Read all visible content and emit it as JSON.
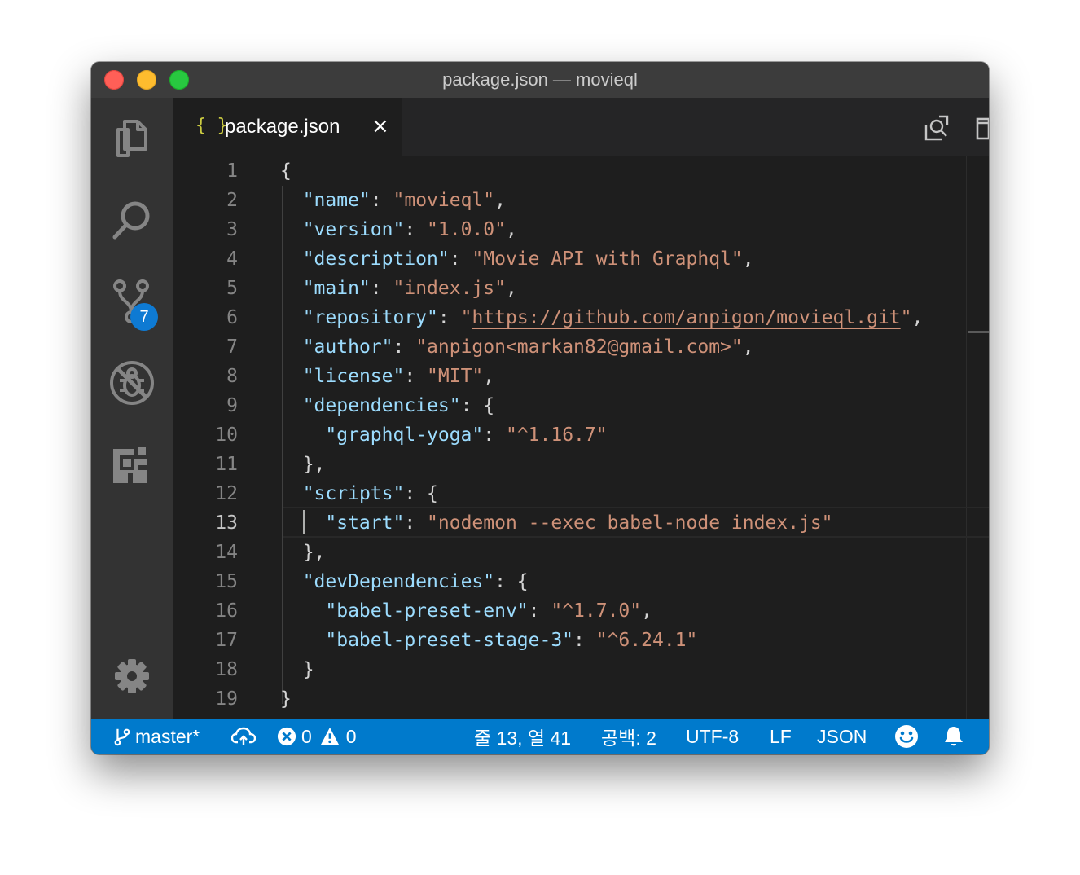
{
  "window": {
    "title": "package.json — movieql"
  },
  "activity_bar": {
    "items": [
      {
        "name": "explorer",
        "icon": "files-icon"
      },
      {
        "name": "search",
        "icon": "search-icon"
      },
      {
        "name": "source-control",
        "icon": "source-control-icon",
        "badge": "7"
      },
      {
        "name": "debug",
        "icon": "debug-disabled-icon"
      },
      {
        "name": "extensions",
        "icon": "extensions-icon"
      }
    ],
    "settings_icon": "gear-icon"
  },
  "tab": {
    "icon_text": "{ }",
    "label": "package.json",
    "close": "×"
  },
  "tab_actions": [
    "open-preview-icon",
    "split-editor-icon",
    "more-actions-icon"
  ],
  "editor": {
    "active_line": 13,
    "lines": [
      {
        "n": "1",
        "tokens": [
          {
            "t": "{",
            "c": "p"
          }
        ]
      },
      {
        "n": "2",
        "tokens": [
          {
            "t": "  ",
            "c": "p"
          },
          {
            "t": "\"name\"",
            "c": "k"
          },
          {
            "t": ": ",
            "c": "p"
          },
          {
            "t": "\"movieql\"",
            "c": "s"
          },
          {
            "t": ",",
            "c": "p"
          }
        ]
      },
      {
        "n": "3",
        "tokens": [
          {
            "t": "  ",
            "c": "p"
          },
          {
            "t": "\"version\"",
            "c": "k"
          },
          {
            "t": ": ",
            "c": "p"
          },
          {
            "t": "\"1.0.0\"",
            "c": "s"
          },
          {
            "t": ",",
            "c": "p"
          }
        ]
      },
      {
        "n": "4",
        "tokens": [
          {
            "t": "  ",
            "c": "p"
          },
          {
            "t": "\"description\"",
            "c": "k"
          },
          {
            "t": ": ",
            "c": "p"
          },
          {
            "t": "\"Movie API with Graphql\"",
            "c": "s"
          },
          {
            "t": ",",
            "c": "p"
          }
        ]
      },
      {
        "n": "5",
        "tokens": [
          {
            "t": "  ",
            "c": "p"
          },
          {
            "t": "\"main\"",
            "c": "k"
          },
          {
            "t": ": ",
            "c": "p"
          },
          {
            "t": "\"index.js\"",
            "c": "s"
          },
          {
            "t": ",",
            "c": "p"
          }
        ]
      },
      {
        "n": "6",
        "tokens": [
          {
            "t": "  ",
            "c": "p"
          },
          {
            "t": "\"repository\"",
            "c": "k"
          },
          {
            "t": ": ",
            "c": "p"
          },
          {
            "t": "\"",
            "c": "s"
          },
          {
            "t": "https://github.com/anpigon/movieql.git",
            "c": "s u"
          },
          {
            "t": "\"",
            "c": "s"
          },
          {
            "t": ",",
            "c": "p"
          }
        ]
      },
      {
        "n": "7",
        "tokens": [
          {
            "t": "  ",
            "c": "p"
          },
          {
            "t": "\"author\"",
            "c": "k"
          },
          {
            "t": ": ",
            "c": "p"
          },
          {
            "t": "\"anpigon<markan82@gmail.com>\"",
            "c": "s"
          },
          {
            "t": ",",
            "c": "p"
          }
        ]
      },
      {
        "n": "8",
        "tokens": [
          {
            "t": "  ",
            "c": "p"
          },
          {
            "t": "\"license\"",
            "c": "k"
          },
          {
            "t": ": ",
            "c": "p"
          },
          {
            "t": "\"MIT\"",
            "c": "s"
          },
          {
            "t": ",",
            "c": "p"
          }
        ]
      },
      {
        "n": "9",
        "tokens": [
          {
            "t": "  ",
            "c": "p"
          },
          {
            "t": "\"dependencies\"",
            "c": "k"
          },
          {
            "t": ": {",
            "c": "p"
          }
        ]
      },
      {
        "n": "10",
        "tokens": [
          {
            "t": "    ",
            "c": "p"
          },
          {
            "t": "\"graphql-yoga\"",
            "c": "k"
          },
          {
            "t": ": ",
            "c": "p"
          },
          {
            "t": "\"^1.16.7\"",
            "c": "s"
          }
        ]
      },
      {
        "n": "11",
        "tokens": [
          {
            "t": "  },",
            "c": "p"
          }
        ]
      },
      {
        "n": "12",
        "tokens": [
          {
            "t": "  ",
            "c": "p"
          },
          {
            "t": "\"scripts\"",
            "c": "k"
          },
          {
            "t": ": {",
            "c": "p"
          }
        ]
      },
      {
        "n": "13",
        "tokens": [
          {
            "t": "    ",
            "c": "p"
          },
          {
            "t": "\"start\"",
            "c": "k"
          },
          {
            "t": ": ",
            "c": "p"
          },
          {
            "t": "\"nodemon --exec babel-node index.js\"",
            "c": "s"
          }
        ]
      },
      {
        "n": "14",
        "tokens": [
          {
            "t": "  },",
            "c": "p"
          }
        ]
      },
      {
        "n": "15",
        "tokens": [
          {
            "t": "  ",
            "c": "p"
          },
          {
            "t": "\"devDependencies\"",
            "c": "k"
          },
          {
            "t": ": {",
            "c": "p"
          }
        ]
      },
      {
        "n": "16",
        "tokens": [
          {
            "t": "    ",
            "c": "p"
          },
          {
            "t": "\"babel-preset-env\"",
            "c": "k"
          },
          {
            "t": ": ",
            "c": "p"
          },
          {
            "t": "\"^1.7.0\"",
            "c": "s"
          },
          {
            "t": ",",
            "c": "p"
          }
        ]
      },
      {
        "n": "17",
        "tokens": [
          {
            "t": "    ",
            "c": "p"
          },
          {
            "t": "\"babel-preset-stage-3\"",
            "c": "k"
          },
          {
            "t": ": ",
            "c": "p"
          },
          {
            "t": "\"^6.24.1\"",
            "c": "s"
          }
        ]
      },
      {
        "n": "18",
        "tokens": [
          {
            "t": "  }",
            "c": "p"
          }
        ]
      },
      {
        "n": "19",
        "tokens": [
          {
            "t": "}",
            "c": "p"
          }
        ]
      }
    ]
  },
  "status_bar": {
    "branch": "master*",
    "errors": "0",
    "warnings": "0",
    "cursor_position": "줄 13, 열 41",
    "indentation": "공백: 2",
    "encoding": "UTF-8",
    "eol": "LF",
    "language": "JSON"
  },
  "colors": {
    "accent": "#007acc",
    "badge": "#0e7ad3",
    "key": "#9cdcfe",
    "string": "#ce9178",
    "punctuation": "#d4d4d4",
    "json_icon": "#cbcb41"
  }
}
